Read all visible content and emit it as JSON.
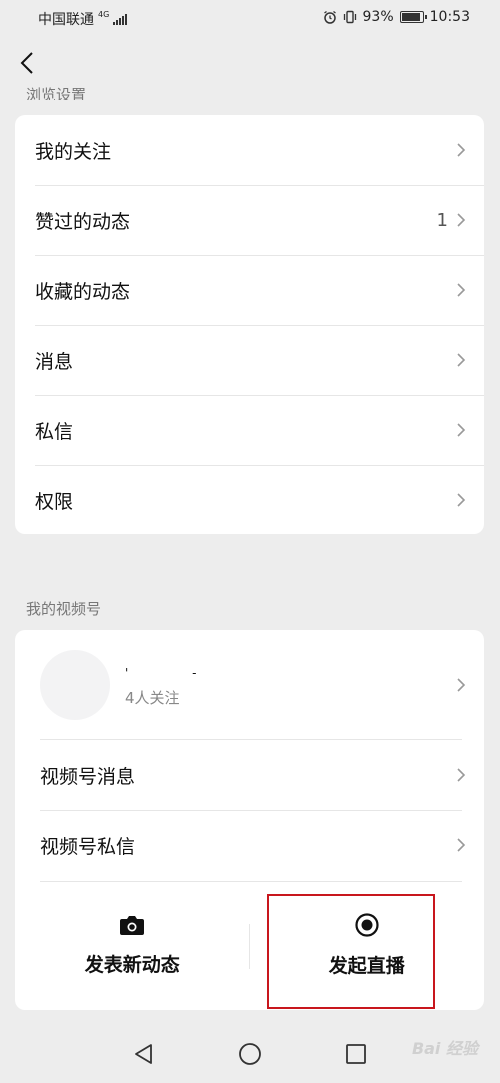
{
  "status_bar": {
    "carrier": "中国联通",
    "network": "4G",
    "battery": "93%",
    "battery_level": 0.93,
    "time": "10:53"
  },
  "browse_settings": {
    "section_title": "浏览设置",
    "items": [
      {
        "label": "我的关注",
        "count": ""
      },
      {
        "label": "赞过的动态",
        "count": "1"
      },
      {
        "label": "收藏的动态",
        "count": ""
      },
      {
        "label": "消息",
        "count": ""
      },
      {
        "label": "私信",
        "count": ""
      },
      {
        "label": "权限",
        "count": ""
      }
    ]
  },
  "channels": {
    "section_title": "我的视频号",
    "profile": {
      "name": "' -",
      "followers": "4人关注"
    },
    "items": [
      {
        "label": "视频号消息"
      },
      {
        "label": "视频号私信"
      }
    ],
    "actions": {
      "post_label": "发表新动态",
      "live_label": "发起直播"
    }
  },
  "watermark": "Bai 经验"
}
